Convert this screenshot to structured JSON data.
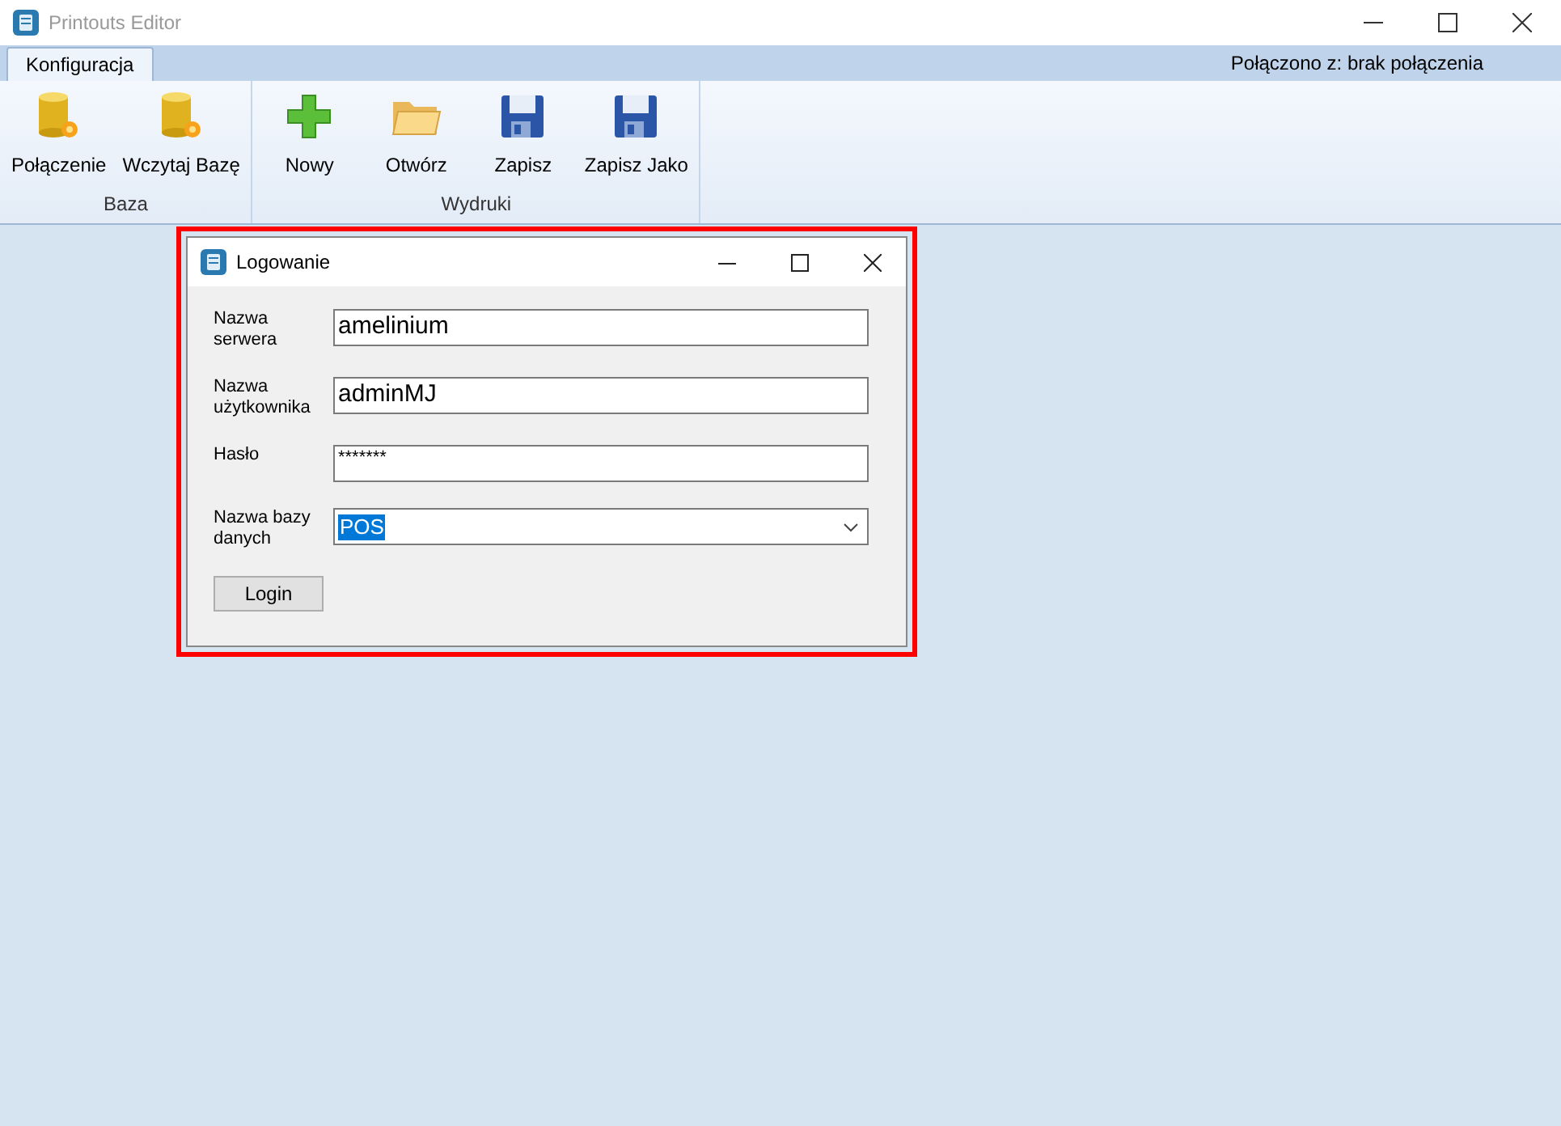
{
  "window": {
    "title": "Printouts Editor"
  },
  "tabs": [
    {
      "label": "Konfiguracja",
      "selected": true
    }
  ],
  "connection_status": "Połączono z: brak połączenia",
  "ribbon": {
    "groups": [
      {
        "label": "Baza",
        "buttons": [
          {
            "label": "Połączenie",
            "kind": "database"
          },
          {
            "label": "Wczytaj Bazę",
            "kind": "database"
          }
        ]
      },
      {
        "label": "Wydruki",
        "buttons": [
          {
            "label": "Nowy",
            "kind": "plus"
          },
          {
            "label": "Otwórz",
            "kind": "folder"
          },
          {
            "label": "Zapisz",
            "kind": "floppy"
          },
          {
            "label": "Zapisz Jako",
            "kind": "floppy"
          }
        ]
      }
    ]
  },
  "dialog": {
    "title": "Logowanie",
    "fields": [
      {
        "label": "Nazwa serwera",
        "kind": "text",
        "value": "amelinium"
      },
      {
        "label": "Nazwa użytkownika",
        "kind": "text",
        "value": "adminMJ"
      },
      {
        "label": "Hasło",
        "kind": "password",
        "value": "*******"
      },
      {
        "label": "Nazwa bazy danych",
        "kind": "combo",
        "value": "POS",
        "selected": true
      }
    ],
    "login_button": "Login"
  }
}
